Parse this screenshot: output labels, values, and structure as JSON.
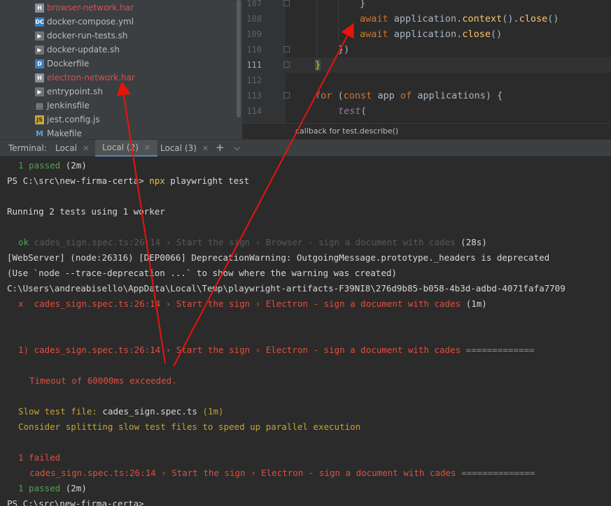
{
  "project_tree": {
    "files": [
      {
        "name": "browser-network.har",
        "icon": "har-file-icon",
        "modified": true
      },
      {
        "name": "docker-compose.yml",
        "icon": "yaml-file-icon",
        "modified": false
      },
      {
        "name": "docker-run-tests.sh",
        "icon": "shell-file-icon",
        "modified": false
      },
      {
        "name": "docker-update.sh",
        "icon": "shell-file-icon",
        "modified": false
      },
      {
        "name": "Dockerfile",
        "icon": "docker-file-icon",
        "modified": false
      },
      {
        "name": "electron-network.har",
        "icon": "har-file-icon",
        "modified": true
      },
      {
        "name": "entrypoint.sh",
        "icon": "shell-file-icon",
        "modified": false
      },
      {
        "name": "Jenkinsfile",
        "icon": "jenkins-file-icon",
        "modified": false
      },
      {
        "name": "jest.config.js",
        "icon": "js-file-icon",
        "modified": false
      },
      {
        "name": "Makefile",
        "icon": "makefile-icon",
        "modified": false
      }
    ]
  },
  "editor": {
    "line_numbers": [
      "107",
      "108",
      "109",
      "110",
      "111",
      "112",
      "113",
      "114"
    ],
    "current_line": "111",
    "lines": {
      "l107": "}",
      "l108_kw": "await",
      "l108_rest_a": " application.",
      "l108_fn1": "context",
      "l108_rest_b": "().",
      "l108_fn2": "close",
      "l108_rest_c": "()",
      "l109_kw": "await",
      "l109_rest_a": " application.",
      "l109_fn": "close",
      "l109_rest_b": "()",
      "l110": "})",
      "l111": "}",
      "l113_kw1": "for",
      "l113_a": " (",
      "l113_kw2": "const",
      "l113_b": " app ",
      "l113_kw3": "of",
      "l113_c": " applications) {",
      "l114_fn": "test",
      "l114_b": "("
    },
    "breadcrumb": "callback for test.describe()"
  },
  "terminal_tabs": {
    "label": "Terminal:",
    "tabs": [
      "Local",
      "Local (2)",
      "Local (3)"
    ],
    "active_tab": "Local (2)",
    "add_icon": "+",
    "dropdown_icon": "chevron-down-icon"
  },
  "terminal": {
    "l1_count": "1 passed",
    "l1_time": " (2m)",
    "prompt": "PS C:\\src\\new-firma-certa> ",
    "command": "npx",
    "command_args": " playwright test",
    "running": "Running 2 tests using 1 worker",
    "ok_mark": "ok",
    "ok_test": " cades_sign.spec.ts:26:14 › Start the sign › Browser - sign a document with cades",
    "ok_time": " (28s)",
    "warn_line": "[WebServer] (node:26316) [DEP0066] DeprecationWarning: OutgoingMessage.prototype._headers is deprecated",
    "use_line": "(Use `node --trace-deprecation ...` to show where the warning was created)",
    "path_line": "C:\\Users\\andreabisello\\AppData\\Local\\Temp\\playwright-artifacts-F39NI8\\276d9b85-b058-4b3d-adbd-4071fafa7709",
    "fail_mark": "x",
    "fail_test": "  cades_sign.spec.ts:26:14 › Start the sign › Electron - sign a document with cades",
    "fail_time": " (1m)",
    "detail_header": "1) cades_sign.spec.ts:26:14 › Start the sign › Electron - sign a document with cades",
    "detail_rule": " =============",
    "timeout": "Timeout of 60000ms exceeded.",
    "slow_label": "Slow test file: ",
    "slow_file": "cades_sign.spec.ts",
    "slow_time": " (1m)",
    "consider": "Consider splitting slow test files to speed up parallel execution",
    "failed_count": "1 failed",
    "failed_test": "cades_sign.spec.ts:26:14 › Start the sign › Electron - sign a document with cades",
    "failed_rule": " ==============",
    "passed_count": "1 passed",
    "passed_time": " (2m)",
    "final_prompt": "PS C:\\src\\new-firma-certa>"
  },
  "annotation": {
    "arrow_color": "#e8140c"
  }
}
